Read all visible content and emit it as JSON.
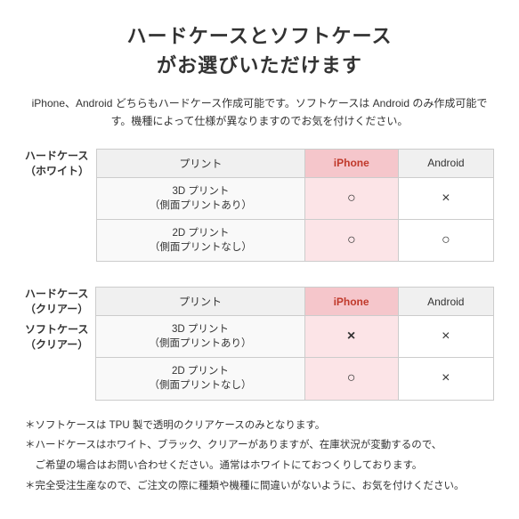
{
  "title": {
    "line1": "ハードケースとソフトケース",
    "line2": "がお選びいただけます"
  },
  "description": "iPhone、Android どちらもハードケース作成可能です。ソフトケースは\nAndroid のみ作成可能です。機種によって仕様が異なりますのでお気を付けください。",
  "table1": {
    "row_header_line1": "ハードケース",
    "row_header_line2": "（ホワイト）",
    "col_headers": [
      "プリント",
      "iPhone",
      "Android"
    ],
    "rows": [
      {
        "print": "3D プリント\n（側面プリントあり）",
        "iphone": "○",
        "android": "×"
      },
      {
        "print": "2D プリント\n（側面プリントなし）",
        "iphone": "○",
        "android": "○"
      }
    ]
  },
  "table2": {
    "row_header_line1": "ハードケース",
    "row_header_line2": "（クリアー）",
    "row_header2_line1": "ソフトケース",
    "row_header2_line2": "（クリアー）",
    "col_headers": [
      "プリント",
      "iPhone",
      "Android"
    ],
    "rows": [
      {
        "print": "3D プリント\n（側面プリントあり）",
        "iphone": "×",
        "android": "×"
      },
      {
        "print": "2D プリント\n（側面プリントなし）",
        "iphone": "○",
        "android": "×"
      }
    ]
  },
  "notes": [
    "＊ソフトケースは TPU 製で透明のクリアケースのみとなります。",
    "＊ハードケースはホワイト、ブラック、クリアーがありますが、在庫状況が変動するので、",
    "　ご希望の場合はお問い合わせください。通常はホワイトにておつくりしております。",
    "＊完全受注生産なので、ご注文の際に種類や機種に間違いがないように、お気を付けください。"
  ]
}
